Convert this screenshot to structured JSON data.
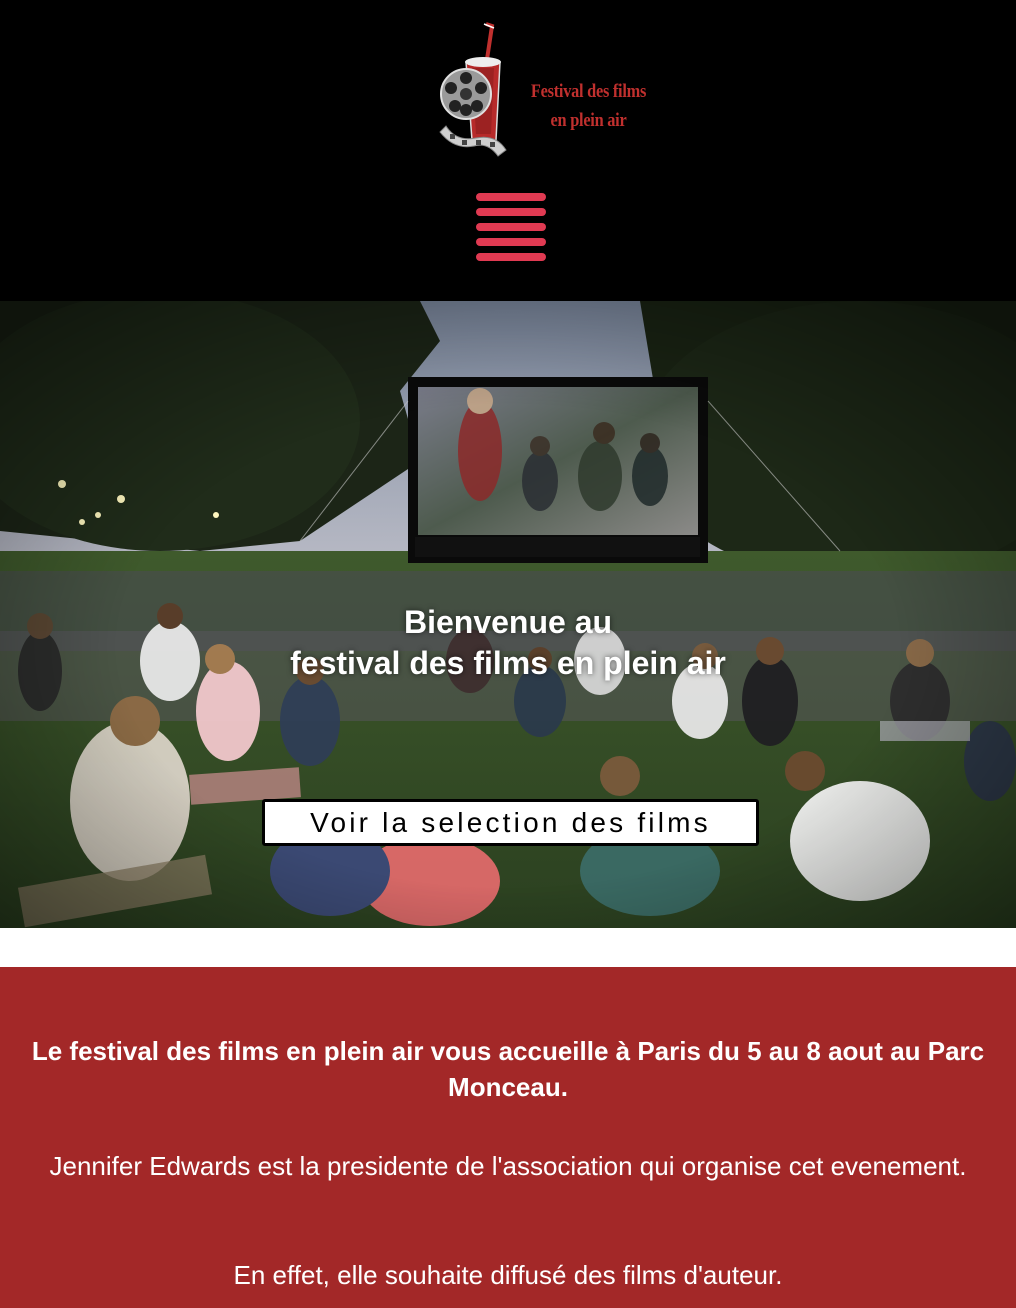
{
  "header": {
    "logo_line1": "Festival des films",
    "logo_line2": "en plein air",
    "menu_icon": "hamburger-menu-icon"
  },
  "hero": {
    "title_line1": "Bienvenue au",
    "title_line2": "festival des films en plein air",
    "cta_label": "Voir la selection des films"
  },
  "info": {
    "lead": "Le festival des films en plein air vous accueille à Paris du 5 au 8 aout au Parc Monceau.",
    "paragraph2": "Jennifer Edwards est la presidente de l'association qui organise cet evenement.",
    "paragraph3": "En effet, elle souhaite diffusé des films d'auteur."
  },
  "colors": {
    "header_bg": "#000000",
    "menu_accent": "#e03a52",
    "logo_text": "#c0302e",
    "info_bg": "#a32828",
    "text_light": "#ffffff"
  }
}
